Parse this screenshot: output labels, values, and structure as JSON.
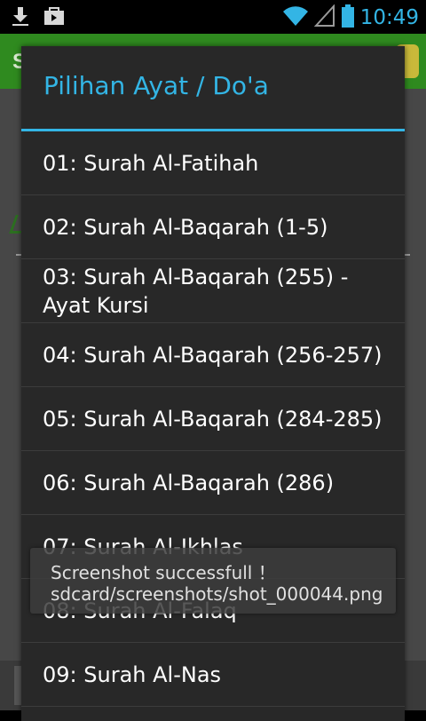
{
  "status_bar": {
    "time": "10:49",
    "icons_left": [
      "download-icon",
      "shop-bag-icon"
    ],
    "icons_right": [
      "wifi-icon",
      "signal-icon",
      "battery-icon"
    ],
    "accent": "#33b5e5"
  },
  "background_app": {
    "header_color": "#2f8a1f",
    "header_letter": "S"
  },
  "dialog": {
    "title": "Pilihan Ayat / Do'a",
    "items": [
      {
        "label": "01: Surah Al-Fatihah"
      },
      {
        "label": "02: Surah Al-Baqarah (1-5)"
      },
      {
        "label": "03: Surah Al-Baqarah (255) - Ayat Kursi"
      },
      {
        "label": "04: Surah Al-Baqarah (256-257)"
      },
      {
        "label": "05: Surah Al-Baqarah (284-285)"
      },
      {
        "label": "06: Surah Al-Baqarah (286)"
      },
      {
        "label": "07: Surah Al-Ikhlas"
      },
      {
        "label": "08: Surah Al-Falaq"
      },
      {
        "label": "09: Surah Al-Nas"
      }
    ]
  },
  "toast": {
    "line1": "Screenshot successfull ！",
    "line2": "sdcard/screenshots/shot_000044.png"
  }
}
